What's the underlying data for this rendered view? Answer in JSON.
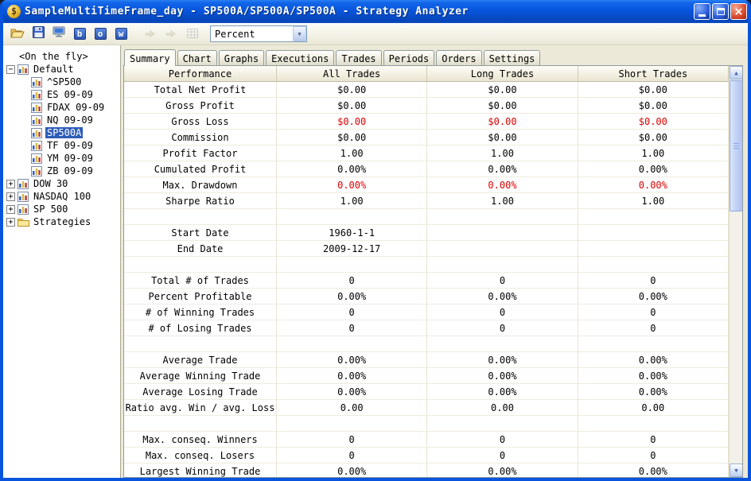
{
  "colors": {
    "negative": "#dd0000",
    "selection": "#2e5cb8",
    "titlebar": "#0855dd"
  },
  "window": {
    "title": "SampleMultiTimeFrame_day - SP500A/SP500A/SP500A - Strategy Analyzer",
    "icon_glyph": "$",
    "controls": {
      "close_glyph": "×"
    }
  },
  "toolbar": {
    "letter_buttons": [
      "b",
      "o",
      "w"
    ],
    "dropdown": {
      "value": "Percent",
      "arrow_glyph": "▼"
    }
  },
  "tabs": {
    "active": "Summary",
    "items": [
      "Summary",
      "Chart",
      "Graphs",
      "Executions",
      "Trades",
      "Periods",
      "Orders",
      "Settings"
    ]
  },
  "tree": {
    "items": [
      {
        "label": "<On the fly>",
        "indent": 0,
        "expander": "",
        "icon": "",
        "selected": false
      },
      {
        "label": "Default",
        "indent": 0,
        "expander": "minus",
        "icon": "chart",
        "selected": false
      },
      {
        "label": "^SP500",
        "indent": 1,
        "expander": "",
        "icon": "chart",
        "selected": false
      },
      {
        "label": "ES 09-09",
        "indent": 1,
        "expander": "",
        "icon": "chart",
        "selected": false
      },
      {
        "label": "FDAX 09-09",
        "indent": 1,
        "expander": "",
        "icon": "chart",
        "selected": false
      },
      {
        "label": "NQ 09-09",
        "indent": 1,
        "expander": "",
        "icon": "chart",
        "selected": false
      },
      {
        "label": "SP500A",
        "indent": 1,
        "expander": "",
        "icon": "chart",
        "selected": true
      },
      {
        "label": "TF 09-09",
        "indent": 1,
        "expander": "",
        "icon": "chart",
        "selected": false
      },
      {
        "label": "YM 09-09",
        "indent": 1,
        "expander": "",
        "icon": "chart",
        "selected": false
      },
      {
        "label": "ZB 09-09",
        "indent": 1,
        "expander": "",
        "icon": "chart",
        "selected": false
      },
      {
        "label": "DOW 30",
        "indent": 0,
        "expander": "plus",
        "icon": "chart",
        "selected": false
      },
      {
        "label": "NASDAQ 100",
        "indent": 0,
        "expander": "plus",
        "icon": "chart",
        "selected": false
      },
      {
        "label": "SP 500",
        "indent": 0,
        "expander": "plus",
        "icon": "chart",
        "selected": false
      },
      {
        "label": "Strategies",
        "indent": 0,
        "expander": "plus",
        "icon": "folder",
        "selected": false
      }
    ]
  },
  "table": {
    "headers": [
      "Performance",
      "All Trades",
      "Long Trades",
      "Short Trades"
    ],
    "rows": [
      {
        "label": "Total Net Profit",
        "values": [
          "$0.00",
          "$0.00",
          "$0.00"
        ],
        "negative": false
      },
      {
        "label": "Gross Profit",
        "values": [
          "$0.00",
          "$0.00",
          "$0.00"
        ],
        "negative": false
      },
      {
        "label": "Gross Loss",
        "values": [
          "$0.00",
          "$0.00",
          "$0.00"
        ],
        "negative": true
      },
      {
        "label": "Commission",
        "values": [
          "$0.00",
          "$0.00",
          "$0.00"
        ],
        "negative": false
      },
      {
        "label": "Profit Factor",
        "values": [
          "1.00",
          "1.00",
          "1.00"
        ],
        "negative": false
      },
      {
        "label": "Cumulated Profit",
        "values": [
          "0.00%",
          "0.00%",
          "0.00%"
        ],
        "negative": false
      },
      {
        "label": "Max. Drawdown",
        "values": [
          "0.00%",
          "0.00%",
          "0.00%"
        ],
        "negative": true
      },
      {
        "label": "Sharpe Ratio",
        "values": [
          "1.00",
          "1.00",
          "1.00"
        ],
        "negative": false
      },
      {
        "label": "",
        "values": [
          "",
          "",
          ""
        ],
        "negative": false
      },
      {
        "label": "Start Date",
        "values": [
          "1960-1-1",
          "",
          ""
        ],
        "negative": false
      },
      {
        "label": "End Date",
        "values": [
          "2009-12-17",
          "",
          ""
        ],
        "negative": false
      },
      {
        "label": "",
        "values": [
          "",
          "",
          ""
        ],
        "negative": false
      },
      {
        "label": "Total # of Trades",
        "values": [
          "0",
          "0",
          "0"
        ],
        "negative": false
      },
      {
        "label": "Percent Profitable",
        "values": [
          "0.00%",
          "0.00%",
          "0.00%"
        ],
        "negative": false
      },
      {
        "label": "# of Winning Trades",
        "values": [
          "0",
          "0",
          "0"
        ],
        "negative": false
      },
      {
        "label": "# of Losing Trades",
        "values": [
          "0",
          "0",
          "0"
        ],
        "negative": false
      },
      {
        "label": "",
        "values": [
          "",
          "",
          ""
        ],
        "negative": false
      },
      {
        "label": "Average Trade",
        "values": [
          "0.00%",
          "0.00%",
          "0.00%"
        ],
        "negative": false
      },
      {
        "label": "Average Winning Trade",
        "values": [
          "0.00%",
          "0.00%",
          "0.00%"
        ],
        "negative": false
      },
      {
        "label": "Average Losing Trade",
        "values": [
          "0.00%",
          "0.00%",
          "0.00%"
        ],
        "negative": false
      },
      {
        "label": "Ratio avg. Win / avg. Loss",
        "values": [
          "0.00",
          "0.00",
          "0.00"
        ],
        "negative": false
      },
      {
        "label": "",
        "values": [
          "",
          "",
          ""
        ],
        "negative": false
      },
      {
        "label": "Max. conseq. Winners",
        "values": [
          "0",
          "0",
          "0"
        ],
        "negative": false
      },
      {
        "label": "Max. conseq. Losers",
        "values": [
          "0",
          "0",
          "0"
        ],
        "negative": false
      },
      {
        "label": "Largest Winning Trade",
        "values": [
          "0.00%",
          "0.00%",
          "0.00%"
        ],
        "negative": false
      }
    ]
  },
  "scrollbar": {
    "up_glyph": "▲",
    "down_glyph": "▼"
  }
}
